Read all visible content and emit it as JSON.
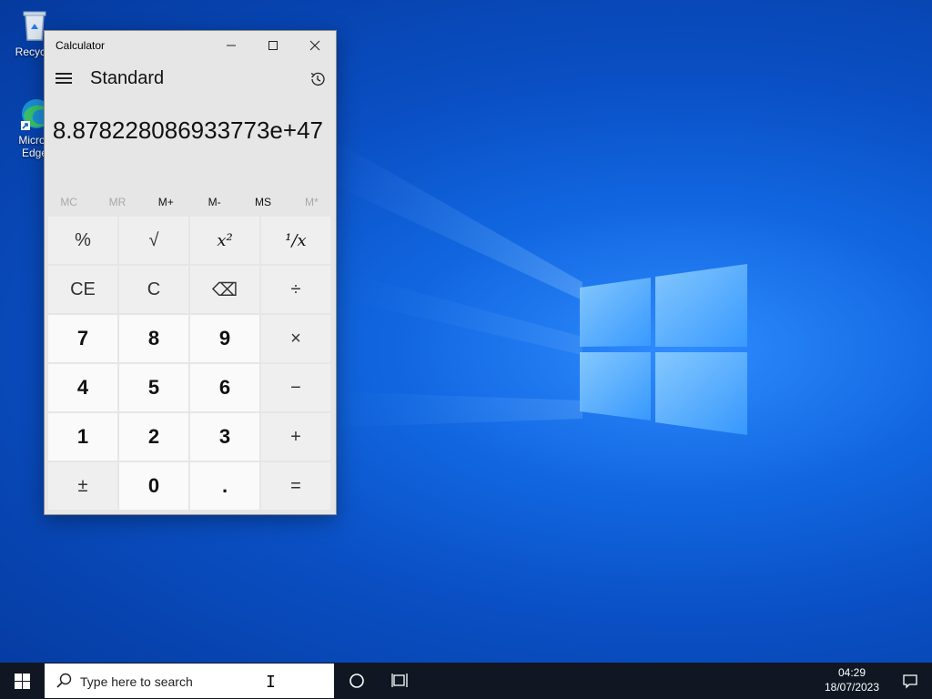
{
  "desktop": {
    "icons": [
      {
        "label": "Recycle",
        "icon": "recycle-bin-icon"
      },
      {
        "label": "Micros Edge",
        "icon": "edge-icon"
      }
    ]
  },
  "calculator": {
    "window_title": "Calculator",
    "mode": "Standard",
    "display": "8.87822808693377​3e+47",
    "memory": [
      {
        "label": "MC",
        "enabled": false
      },
      {
        "label": "MR",
        "enabled": false
      },
      {
        "label": "M+",
        "enabled": true
      },
      {
        "label": "M-",
        "enabled": true
      },
      {
        "label": "MS",
        "enabled": true
      },
      {
        "label": "M*",
        "enabled": false
      }
    ],
    "keys": [
      {
        "label": "%",
        "name": "percent-button",
        "kind": "op"
      },
      {
        "label": "√",
        "name": "square-root-button",
        "kind": "op"
      },
      {
        "label": "x²",
        "name": "square-button",
        "kind": "sym"
      },
      {
        "label": "¹/x",
        "name": "reciprocal-button",
        "kind": "sym"
      },
      {
        "label": "CE",
        "name": "clear-entry-button",
        "kind": "op"
      },
      {
        "label": "C",
        "name": "clear-button",
        "kind": "op"
      },
      {
        "label": "⌫",
        "name": "backspace-button",
        "kind": "op"
      },
      {
        "label": "÷",
        "name": "divide-button",
        "kind": "op"
      },
      {
        "label": "7",
        "name": "digit-7-button",
        "kind": "num"
      },
      {
        "label": "8",
        "name": "digit-8-button",
        "kind": "num"
      },
      {
        "label": "9",
        "name": "digit-9-button",
        "kind": "num"
      },
      {
        "label": "×",
        "name": "multiply-button",
        "kind": "op"
      },
      {
        "label": "4",
        "name": "digit-4-button",
        "kind": "num"
      },
      {
        "label": "5",
        "name": "digit-5-button",
        "kind": "num"
      },
      {
        "label": "6",
        "name": "digit-6-button",
        "kind": "num"
      },
      {
        "label": "−",
        "name": "subtract-button",
        "kind": "op"
      },
      {
        "label": "1",
        "name": "digit-1-button",
        "kind": "num"
      },
      {
        "label": "2",
        "name": "digit-2-button",
        "kind": "num"
      },
      {
        "label": "3",
        "name": "digit-3-button",
        "kind": "num"
      },
      {
        "label": "+",
        "name": "add-button",
        "kind": "op"
      },
      {
        "label": "±",
        "name": "negate-button",
        "kind": "op"
      },
      {
        "label": "0",
        "name": "digit-0-button",
        "kind": "num"
      },
      {
        "label": ".",
        "name": "decimal-button",
        "kind": "num"
      },
      {
        "label": "=",
        "name": "equals-button",
        "kind": "op"
      }
    ]
  },
  "taskbar": {
    "search_placeholder": "Type here to search",
    "time": "04:29",
    "date": "18/07/2023"
  }
}
